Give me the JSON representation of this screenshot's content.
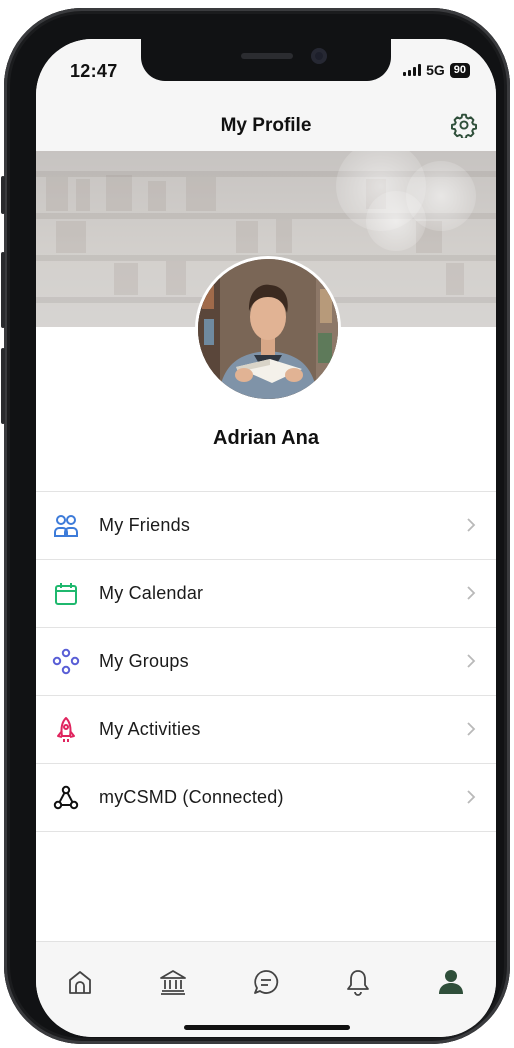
{
  "status_bar": {
    "time": "12:47",
    "network": "5G",
    "battery": "90"
  },
  "header": {
    "title": "My Profile",
    "settings_icon": "gear-icon"
  },
  "profile": {
    "name": "Adrian Ana"
  },
  "menu": {
    "items": [
      {
        "label": "My Friends",
        "icon": "friends-icon",
        "color": "#3d7bd9"
      },
      {
        "label": "My Calendar",
        "icon": "calendar-icon",
        "color": "#1fb86e"
      },
      {
        "label": "My Groups",
        "icon": "groups-icon",
        "color": "#5a5fd6"
      },
      {
        "label": "My Activities",
        "icon": "rocket-icon",
        "color": "#e0245e"
      },
      {
        "label": "myCSMD (Connected)",
        "icon": "network-icon",
        "color": "#111111"
      }
    ]
  },
  "tab_bar": {
    "tabs": [
      {
        "icon": "home-icon",
        "active": false
      },
      {
        "icon": "institution-icon",
        "active": false
      },
      {
        "icon": "chat-icon",
        "active": false
      },
      {
        "icon": "bell-icon",
        "active": false
      },
      {
        "icon": "profile-icon",
        "active": true
      }
    ],
    "active_color": "#2f4f3a",
    "inactive_color": "#444444"
  }
}
